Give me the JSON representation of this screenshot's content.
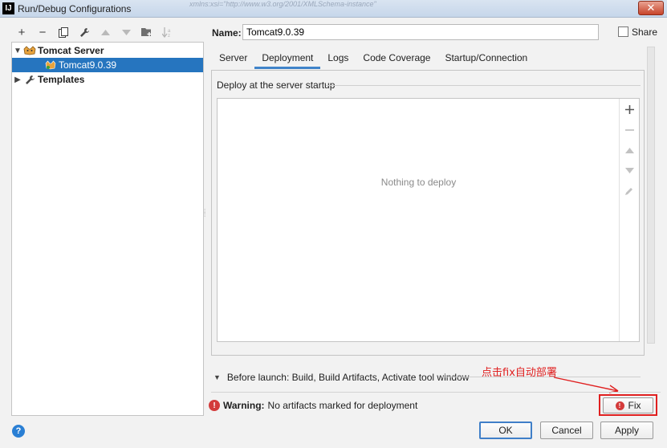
{
  "window": {
    "title": "Run/Debug Configurations",
    "app_icon": "IJ",
    "ghost_text": "xmlns:xsi=\"http://www.w3.org/2001/XMLSchema-instance\"",
    "close_glyph": "✕"
  },
  "toolbar": {
    "add": "+",
    "remove": "−",
    "copy": "⧉",
    "edit": "🔧",
    "up": "▲",
    "down": "▼",
    "folder": "📁",
    "sort": "↓a"
  },
  "tree": {
    "group": {
      "label": "Tomcat Server",
      "expanded": true
    },
    "child": {
      "label": "Tomcat9.0.39",
      "selected": true
    },
    "templates": {
      "label": "Templates"
    }
  },
  "form": {
    "name_label": "Name:",
    "name_value": "Tomcat9.0.39",
    "share_label": "Share",
    "share_checked": false
  },
  "tabs": [
    {
      "label": "Server",
      "active": false
    },
    {
      "label": "Deployment",
      "active": true
    },
    {
      "label": "Logs",
      "active": false
    },
    {
      "label": "Code Coverage",
      "active": false
    },
    {
      "label": "Startup/Connection",
      "active": false
    }
  ],
  "deployment": {
    "section_title": "Deploy at the server startup",
    "empty_text": "Nothing to deploy"
  },
  "before_launch": {
    "label": "Before launch: Build, Build Artifacts, Activate tool window"
  },
  "annotation": {
    "text": "点击fix自动部署",
    "color": "#e02020"
  },
  "warning": {
    "prefix": "Warning:",
    "message": "No artifacts marked for deployment"
  },
  "buttons": {
    "fix": "Fix",
    "ok": "OK",
    "cancel": "Cancel",
    "apply": "Apply",
    "help": "?"
  },
  "colors": {
    "selection": "#2675bf",
    "tab_underline": "#4083c9",
    "warning": "#d33a3a"
  }
}
